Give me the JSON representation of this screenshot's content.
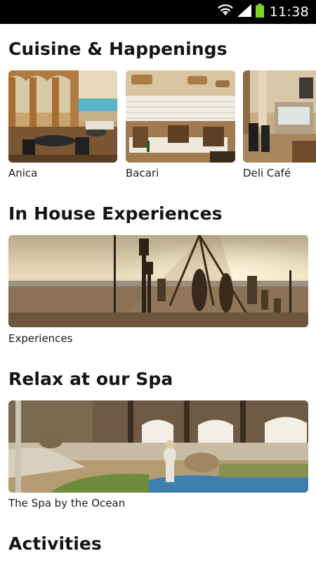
{
  "status_bar": {
    "time": "11:38",
    "icons": [
      "wifi-icon",
      "signal-icon",
      "battery-icon"
    ],
    "battery_color": "#7ed321"
  },
  "sections": {
    "cuisine": {
      "title": "Cuisine & Happenings",
      "items": [
        {
          "label": "Anica"
        },
        {
          "label": "Bacari"
        },
        {
          "label": "Deli Café"
        }
      ]
    },
    "experiences": {
      "title": "In House Experiences",
      "items": [
        {
          "label": "Experiences"
        }
      ]
    },
    "spa": {
      "title": "Relax at our Spa",
      "items": [
        {
          "label": "The Spa by the Ocean"
        }
      ]
    },
    "activities": {
      "title": "Activities"
    }
  }
}
